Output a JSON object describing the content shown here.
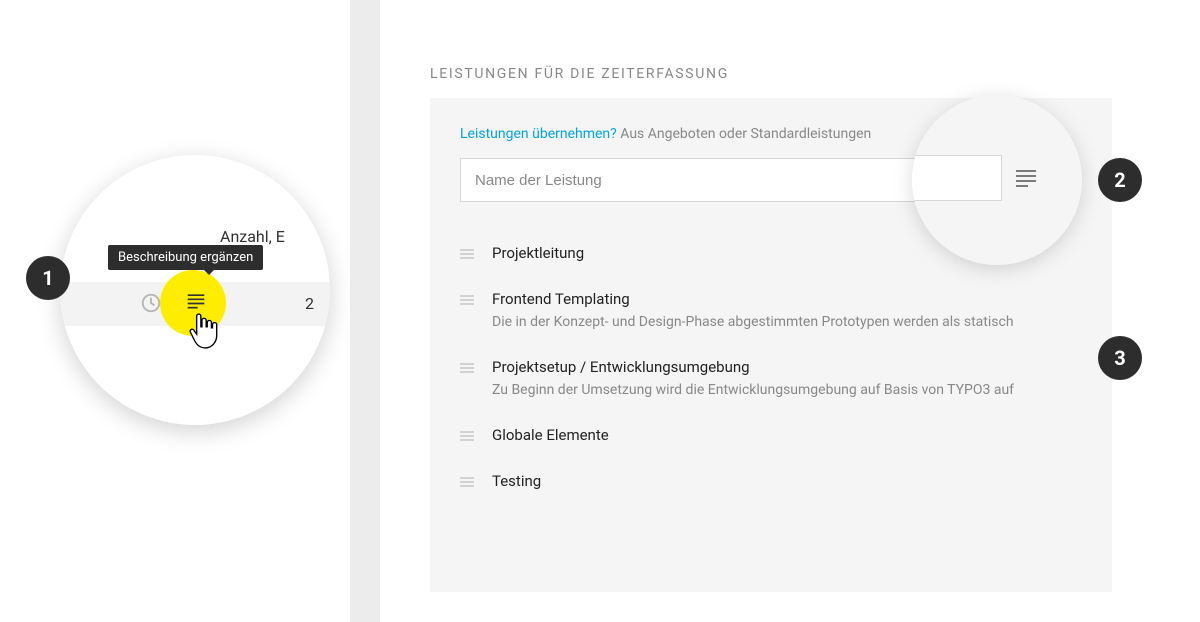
{
  "zoom1": {
    "column_label": "Anzahl, E",
    "tooltip": "Beschreibung ergänzen",
    "qty": "2"
  },
  "section_title": "LEISTUNGEN FÜR DIE ZEITERFASSUNG",
  "takeover": {
    "link": "Leistungen übernehmen?",
    "text": "Aus Angeboten oder Standardleistungen"
  },
  "input": {
    "placeholder": "Name der Leistung"
  },
  "services": [
    {
      "title": "Projektleitung",
      "desc": ""
    },
    {
      "title": "Frontend Templating",
      "desc": "Die in der Konzept- und Design-Phase abgestimmten Prototypen werden als statisch"
    },
    {
      "title": "Projektsetup / Entwicklungsumgebung",
      "desc": "Zu Beginn der Umsetzung wird die Entwicklungsumgebung auf Basis von TYPO3 auf"
    },
    {
      "title": "Globale Elemente",
      "desc": ""
    },
    {
      "title": "Testing",
      "desc": ""
    }
  ],
  "badges": {
    "one": "1",
    "two": "2",
    "three": "3"
  }
}
